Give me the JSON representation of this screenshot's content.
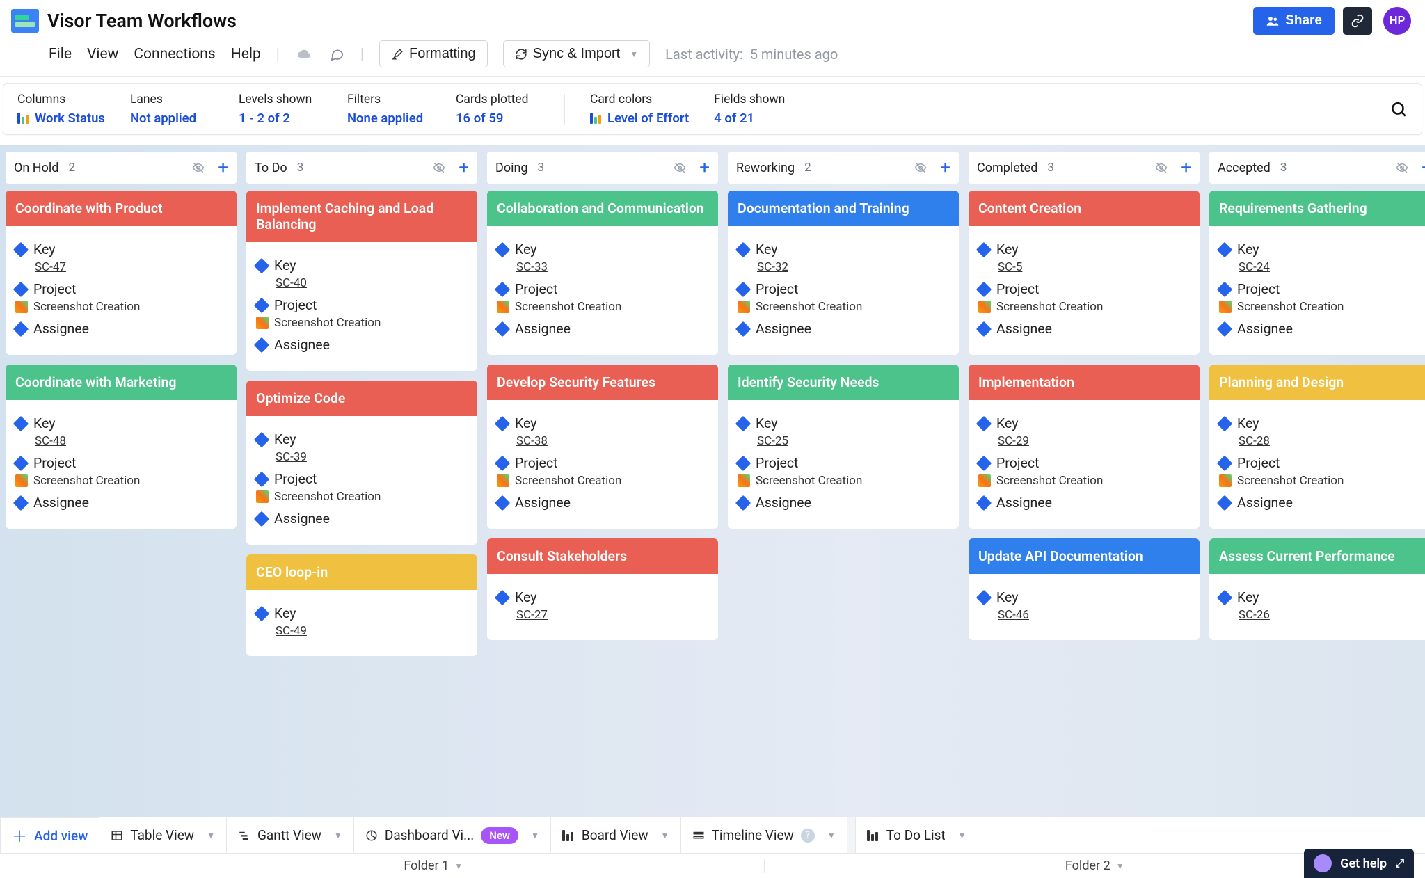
{
  "app": {
    "title": "Visor Team Workflows",
    "avatar_initials": "HP",
    "share_label": "Share"
  },
  "menu": {
    "file": "File",
    "view": "View",
    "connections": "Connections",
    "help": "Help",
    "formatting": "Formatting",
    "sync": "Sync & Import",
    "last_activity_label": "Last activity:",
    "last_activity_value": "5 minutes ago"
  },
  "filters": {
    "columns_label": "Columns",
    "columns_value": "Work Status",
    "lanes_label": "Lanes",
    "lanes_value": "Not applied",
    "levels_label": "Levels shown",
    "levels_value": "1 - 2 of 2",
    "filters_label": "Filters",
    "filters_value": "None applied",
    "cards_label": "Cards plotted",
    "cards_value": "16 of 59",
    "cardcolors_label": "Card colors",
    "cardcolors_value": "Level of Effort",
    "fields_label": "Fields shown",
    "fields_value": "4 of 21"
  },
  "labels": {
    "key": "Key",
    "project": "Project",
    "assignee": "Assignee",
    "project_value": "Screenshot Creation"
  },
  "columns": [
    {
      "name": "On Hold",
      "count": "2",
      "cards": [
        {
          "title": "Coordinate with Product",
          "color": "c-red",
          "key": "SC-47"
        },
        {
          "title": "Coordinate with Marketing",
          "color": "c-green",
          "key": "SC-48"
        }
      ]
    },
    {
      "name": "To Do",
      "count": "3",
      "cards": [
        {
          "title": "Implement Caching and Load Balancing",
          "color": "c-red",
          "key": "SC-40"
        },
        {
          "title": "Optimize Code",
          "color": "c-red",
          "key": "SC-39"
        },
        {
          "title": "CEO loop-in",
          "color": "c-yellow",
          "key": "SC-49"
        }
      ]
    },
    {
      "name": "Doing",
      "count": "3",
      "cards": [
        {
          "title": "Collaboration and Communication",
          "color": "c-green",
          "key": "SC-33"
        },
        {
          "title": "Develop Security Features",
          "color": "c-red",
          "key": "SC-38"
        },
        {
          "title": "Consult Stakeholders",
          "color": "c-red",
          "key": "SC-27"
        }
      ]
    },
    {
      "name": "Reworking",
      "count": "2",
      "cards": [
        {
          "title": "Documentation and Training",
          "color": "c-blue",
          "key": "SC-32"
        },
        {
          "title": "Identify Security Needs",
          "color": "c-green",
          "key": "SC-25"
        }
      ]
    },
    {
      "name": "Completed",
      "count": "3",
      "cards": [
        {
          "title": "Content Creation",
          "color": "c-red",
          "key": "SC-5"
        },
        {
          "title": "Implementation",
          "color": "c-red",
          "key": "SC-29"
        },
        {
          "title": "Update API Documentation",
          "color": "c-blue",
          "key": "SC-46"
        }
      ]
    },
    {
      "name": "Accepted",
      "count": "3",
      "cards": [
        {
          "title": "Requirements Gathering",
          "color": "c-green",
          "key": "SC-24"
        },
        {
          "title": "Planning and Design",
          "color": "c-yellow",
          "key": "SC-28"
        },
        {
          "title": "Assess Current Performance",
          "color": "c-green",
          "key": "SC-26"
        }
      ]
    }
  ],
  "views": {
    "add": "Add view",
    "table": "Table View",
    "gantt": "Gantt View",
    "dashboard": "Dashboard Vi...",
    "new_badge": "New",
    "board": "Board View",
    "timeline": "Timeline View",
    "todo": "To Do List"
  },
  "folders": {
    "f1": "Folder 1",
    "f2": "Folder 2"
  },
  "help": {
    "label": "Get help"
  }
}
